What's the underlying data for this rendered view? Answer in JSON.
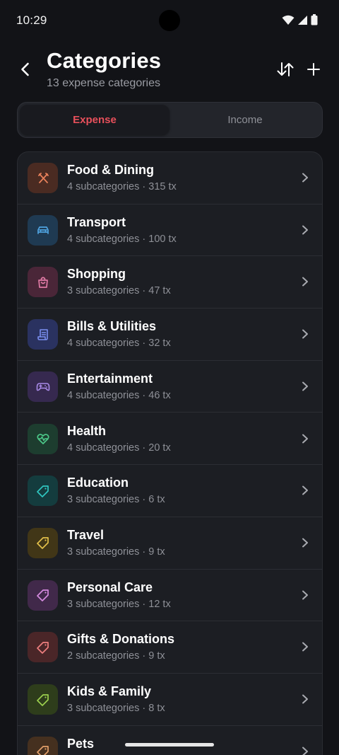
{
  "status_bar": {
    "time": "10:29"
  },
  "header": {
    "title": "Categories",
    "subtitle": "13 expense categories"
  },
  "tabs": [
    {
      "label": "Expense",
      "selected": true
    },
    {
      "label": "Income",
      "selected": false
    }
  ],
  "colors": {
    "background": "#121317",
    "card": "#1c1e23",
    "accent_expense": "#e8505b"
  },
  "categories": [
    {
      "name": "Food & Dining",
      "meta": "4 subcategories · 315 tx",
      "icon": "fork-knife-icon",
      "icon_color": "#e8805a",
      "icon_bg": "#4a2b22"
    },
    {
      "name": "Transport",
      "meta": "4 subcategories · 100 tx",
      "icon": "car-icon",
      "icon_color": "#4fa3e0",
      "icon_bg": "#1f3a52"
    },
    {
      "name": "Shopping",
      "meta": "3 subcategories · 47 tx",
      "icon": "shopping-bag-icon",
      "icon_color": "#e07aa5",
      "icon_bg": "#4a2638"
    },
    {
      "name": "Bills & Utilities",
      "meta": "4 subcategories · 32 tx",
      "icon": "receipt-icon",
      "icon_color": "#7b8ff0",
      "icon_bg": "#2a3260"
    },
    {
      "name": "Entertainment",
      "meta": "4 subcategories · 46 tx",
      "icon": "gamepad-icon",
      "icon_color": "#a98ae8",
      "icon_bg": "#36294f"
    },
    {
      "name": "Health",
      "meta": "4 subcategories · 20 tx",
      "icon": "heart-pulse-icon",
      "icon_color": "#4cc98a",
      "icon_bg": "#1d3d2f"
    },
    {
      "name": "Education",
      "meta": "3 subcategories · 6 tx",
      "icon": "tag-icon",
      "icon_color": "#2fc6c0",
      "icon_bg": "#143c3e"
    },
    {
      "name": "Travel",
      "meta": "3 subcategories · 9 tx",
      "icon": "tag-icon",
      "icon_color": "#e3c04a",
      "icon_bg": "#413617"
    },
    {
      "name": "Personal Care",
      "meta": "3 subcategories · 12 tx",
      "icon": "tag-icon",
      "icon_color": "#d68be0",
      "icon_bg": "#41294a"
    },
    {
      "name": "Gifts & Donations",
      "meta": "2 subcategories · 9 tx",
      "icon": "tag-icon",
      "icon_color": "#ef7f7f",
      "icon_bg": "#4a2628"
    },
    {
      "name": "Kids & Family",
      "meta": "3 subcategories · 8 tx",
      "icon": "tag-icon",
      "icon_color": "#9cd04e",
      "icon_bg": "#2e3d1b"
    },
    {
      "name": "Pets",
      "meta": "",
      "icon": "tag-icon",
      "icon_color": "#e3a06a",
      "icon_bg": "#45301f"
    }
  ]
}
